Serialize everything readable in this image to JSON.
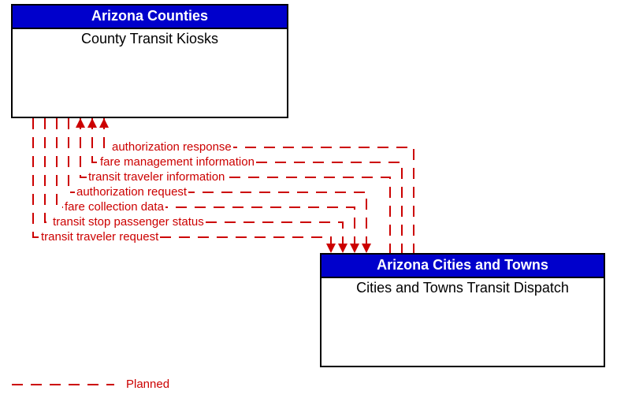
{
  "boxes": {
    "top": {
      "header": "Arizona Counties",
      "title": "County Transit Kiosks"
    },
    "bottom": {
      "header": "Arizona Cities and Towns",
      "title": "Cities and Towns Transit Dispatch"
    }
  },
  "flows": {
    "to_top": [
      "authorization response",
      "fare management information",
      "transit traveler information"
    ],
    "to_bottom": [
      "authorization request",
      "fare collection data",
      "transit stop passenger status",
      "transit traveler request"
    ]
  },
  "legend": {
    "planned": "Planned"
  }
}
